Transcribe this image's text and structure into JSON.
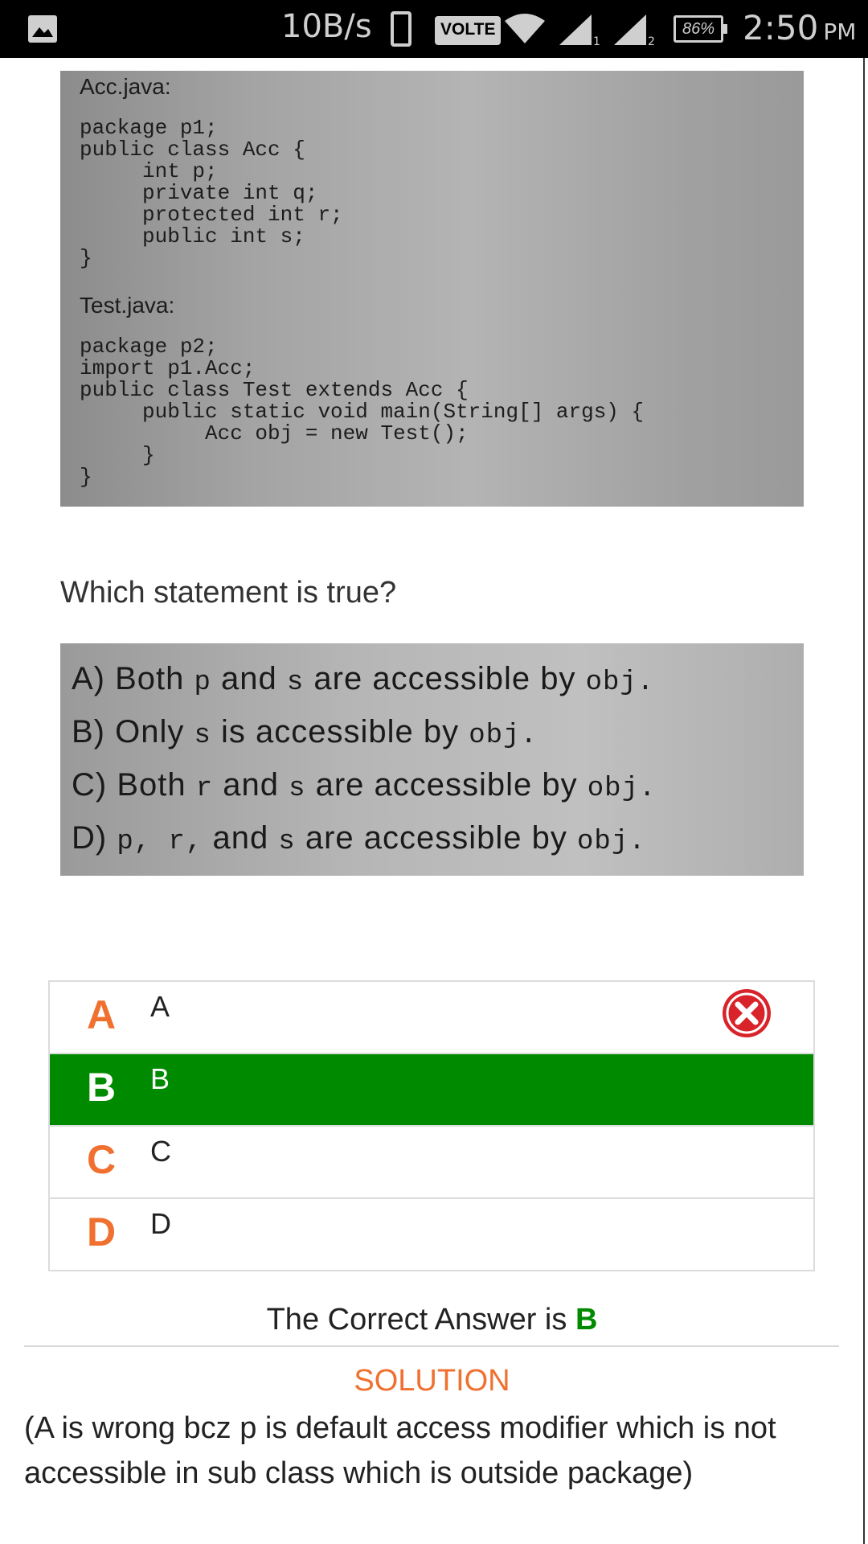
{
  "status_bar": {
    "net_speed": "10B/s",
    "volte": "VOLTE",
    "sim1": "1",
    "sim2": "2",
    "battery": "86%",
    "time": "2:50",
    "ampm": "PM"
  },
  "code_image": {
    "file1_name": "Acc.java:",
    "file1_code": "package p1;\npublic class Acc {\n     int p;\n     private int q;\n     protected int r;\n     public int s;\n}",
    "file2_name": "Test.java:",
    "file2_code": "package p2;\nimport p1.Acc;\npublic class Test extends Acc {\n     public static void main(String[] args) {\n          Acc obj = new Test();\n     }\n}"
  },
  "question": "Which statement is true?",
  "options_image": [
    {
      "prefix": "A) Both ",
      "m1": "p",
      "mid": " and ",
      "m2": "s",
      "suffix": " are accessible by ",
      "obj": "obj."
    },
    {
      "prefix": "B) Only ",
      "m1": "s",
      "mid": " is accessible by ",
      "m2": "",
      "suffix": "",
      "obj": "obj."
    },
    {
      "prefix": "C) Both ",
      "m1": "r",
      "mid": " and ",
      "m2": "s",
      "suffix": " are accessible by ",
      "obj": "obj."
    },
    {
      "prefix": "D) ",
      "m1": "p, r,",
      "mid": " and ",
      "m2": "s",
      "suffix": " are accessible by ",
      "obj": "obj."
    }
  ],
  "answers": [
    {
      "letter": "A",
      "text": "A",
      "state": "wrong"
    },
    {
      "letter": "B",
      "text": "B",
      "state": "correct"
    },
    {
      "letter": "C",
      "text": "C",
      "state": "none"
    },
    {
      "letter": "D",
      "text": "D",
      "state": "none"
    }
  ],
  "result": {
    "prefix": "The Correct Answer is",
    "answer": "B"
  },
  "solution": {
    "heading": "SOLUTION",
    "text": "(A is wrong bcz p is default access modifier which is not accessible in sub class which is outside package)"
  },
  "colors": {
    "correct_green": "#008a00",
    "accent_orange": "#f07030",
    "wrong_red": "#d9232a"
  }
}
